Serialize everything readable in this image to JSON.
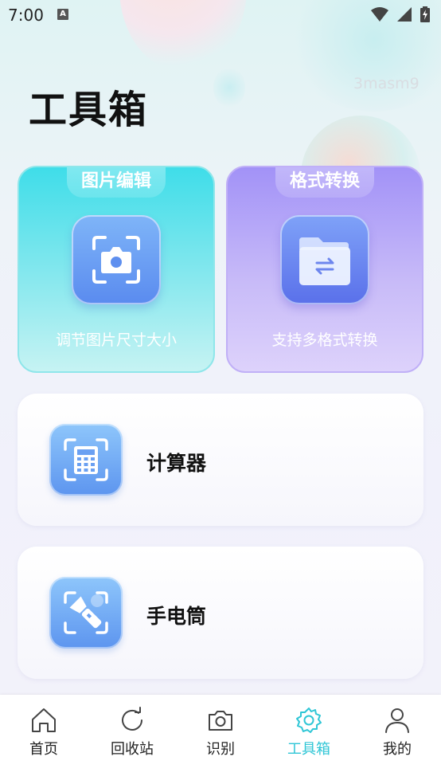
{
  "status_bar": {
    "time": "7:00",
    "notification_badge": "A"
  },
  "page": {
    "title": "工具箱",
    "watermark": "3masm9"
  },
  "feature_cards": [
    {
      "tab": "图片编辑",
      "desc": "调节图片尺寸大小",
      "icon": "camera-scan-icon"
    },
    {
      "tab": "格式转换",
      "desc": "支持多格式转换",
      "icon": "folder-swap-icon"
    }
  ],
  "tools": [
    {
      "label": "计算器",
      "icon": "calculator-icon"
    },
    {
      "label": "手电筒",
      "icon": "flashlight-icon"
    }
  ],
  "bottom_nav": [
    {
      "label": "首页",
      "icon": "home-icon"
    },
    {
      "label": "回收站",
      "icon": "refresh-icon"
    },
    {
      "label": "识别",
      "icon": "camera-icon"
    },
    {
      "label": "工具箱",
      "icon": "gear-icon",
      "active": true
    },
    {
      "label": "我的",
      "icon": "user-icon"
    }
  ],
  "colors": {
    "accent": "#2fc6d6",
    "edit_card": "#3fdde9",
    "format_card": "#a292f7",
    "tool_icon": "#6fa5f3"
  }
}
